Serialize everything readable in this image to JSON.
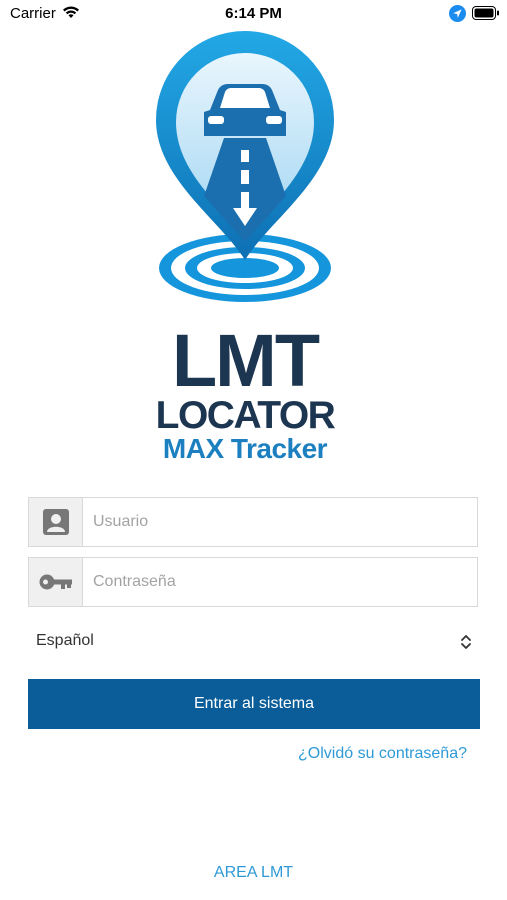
{
  "status_bar": {
    "carrier": "Carrier",
    "time": "6:14 PM"
  },
  "logo": {
    "line1": "LMT",
    "line2": "LOCATOR",
    "line3": "MAX Tracker"
  },
  "login_form": {
    "username_placeholder": "Usuario",
    "password_placeholder": "Contraseña",
    "language_selected": "Español",
    "submit_label": "Entrar al sistema",
    "forgot_password_label": "¿Olvidó su contraseña?"
  },
  "footer": {
    "area_link_label": "AREA LMT"
  },
  "colors": {
    "primary_button": "#0a5d98",
    "link": "#2f9ad6",
    "logo_dark": "#1c3550",
    "logo_blue": "#1b7fc0"
  }
}
